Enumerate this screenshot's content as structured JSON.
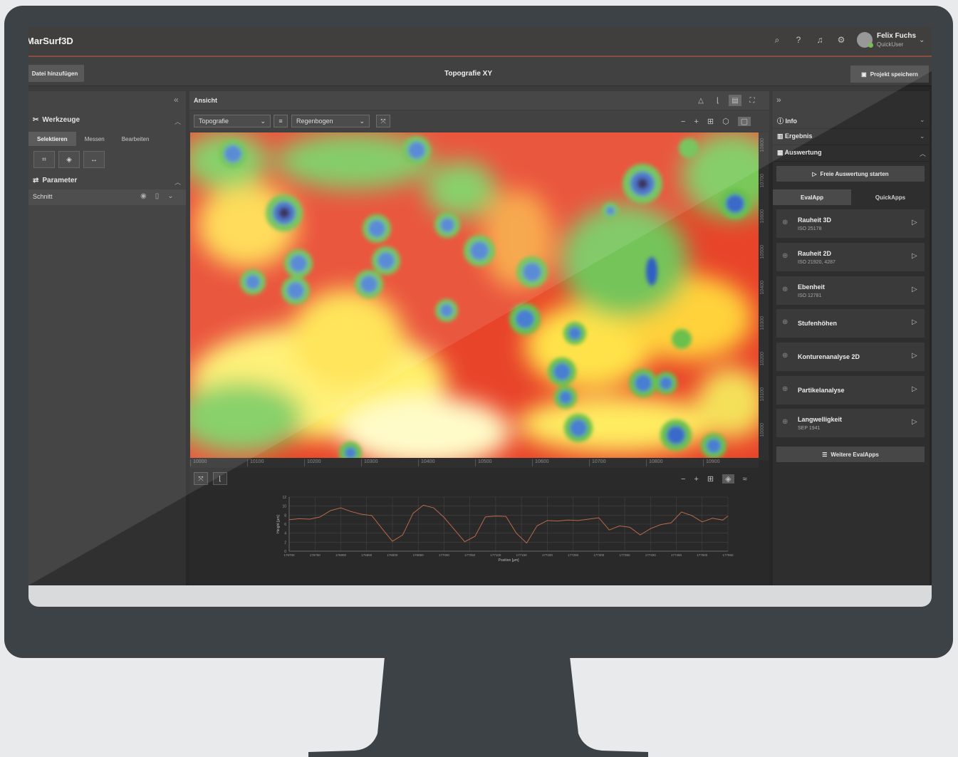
{
  "app": {
    "name": "MarSurf3D",
    "page_title": "Topografie XY"
  },
  "header": {
    "icons": [
      "search-icon",
      "help-icon",
      "bell-icon",
      "settings-icon"
    ],
    "user_name": "Felix Fuchs",
    "user_role": "QuickUser"
  },
  "toolbar": {
    "add_file": "Datei hinzufügen",
    "save_project": "Projekt speichern"
  },
  "left_panel": {
    "tools_title": "Werkzeuge",
    "tabs": [
      "Selektieren",
      "Messen",
      "Bearbeiten"
    ],
    "params_title": "Parameter",
    "row_label": "Schnitt"
  },
  "center": {
    "view_title": "Ansicht",
    "view_select": "Topografie",
    "palette_select": "Regenbogen",
    "x_ticks": [
      "10000",
      "10100",
      "10200",
      "10300",
      "10400",
      "10500",
      "10600",
      "10700",
      "10800",
      "10900"
    ],
    "y_ticks": [
      "10000",
      "10100",
      "10200",
      "10300",
      "10400",
      "10500",
      "10600",
      "10700",
      "10800"
    ]
  },
  "right_panel": {
    "sections": {
      "info": "Info",
      "result": "Ergebnis",
      "eval": "Auswertung"
    },
    "start_button": "Freie Auswertung starten",
    "tabs": [
      "EvalApp",
      "QuickApps"
    ],
    "apps": [
      {
        "title": "Rauheit 3D",
        "subtitle": "ISO 25178"
      },
      {
        "title": "Rauheit 2D",
        "subtitle": "ISO 21920, 4287"
      },
      {
        "title": "Ebenheit",
        "subtitle": "ISO 12781"
      },
      {
        "title": "Stufenhöhen",
        "subtitle": ""
      },
      {
        "title": "Konturenanalyse 2D",
        "subtitle": ""
      },
      {
        "title": "Partikelanalyse",
        "subtitle": ""
      },
      {
        "title": "Langwelligkeit",
        "subtitle": "SEP 1941"
      }
    ],
    "more_button": "Weitere EvalApps"
  },
  "chart_data": {
    "type": "line",
    "xlabel": "Position [µm]",
    "ylabel": "Height [µm]",
    "xlim": [
      176700,
      177550
    ],
    "ylim": [
      0,
      12
    ],
    "y_ticks": [
      "0",
      "2",
      "4",
      "6",
      "8",
      "10",
      "12"
    ],
    "x_ticks": [
      "176700",
      "176750",
      "176800",
      "176850",
      "176900",
      "176950",
      "177000",
      "177050",
      "177100",
      "177150",
      "177200",
      "177250",
      "177300",
      "177350",
      "177400",
      "177450",
      "177500",
      "177550"
    ],
    "series": [
      {
        "color": "#b86a4a",
        "x": [
          176700,
          176720,
          176740,
          176760,
          176780,
          176800,
          176820,
          176840,
          176860,
          176880,
          176900,
          176920,
          176940,
          176960,
          176980,
          177000,
          177020,
          177040,
          177060,
          177080,
          177100,
          177120,
          177140,
          177160,
          177180,
          177200,
          177220,
          177240,
          177260,
          177280,
          177300,
          177320,
          177340,
          177360,
          177380,
          177400,
          177420,
          177440,
          177460,
          177480,
          177500,
          177520,
          177540,
          177550
        ],
        "y": [
          7.0,
          7.2,
          7.1,
          7.6,
          9.0,
          9.6,
          8.8,
          8.2,
          7.9,
          5.0,
          2.2,
          3.6,
          8.4,
          10.2,
          9.6,
          7.5,
          4.8,
          2.1,
          3.3,
          7.6,
          7.8,
          7.7,
          4.0,
          1.8,
          5.6,
          6.8,
          6.7,
          6.9,
          6.8,
          7.1,
          7.4,
          4.7,
          5.6,
          5.3,
          3.6,
          5.0,
          5.9,
          6.3,
          8.7,
          7.9,
          6.5,
          7.3,
          6.9,
          7.8
        ]
      }
    ]
  }
}
